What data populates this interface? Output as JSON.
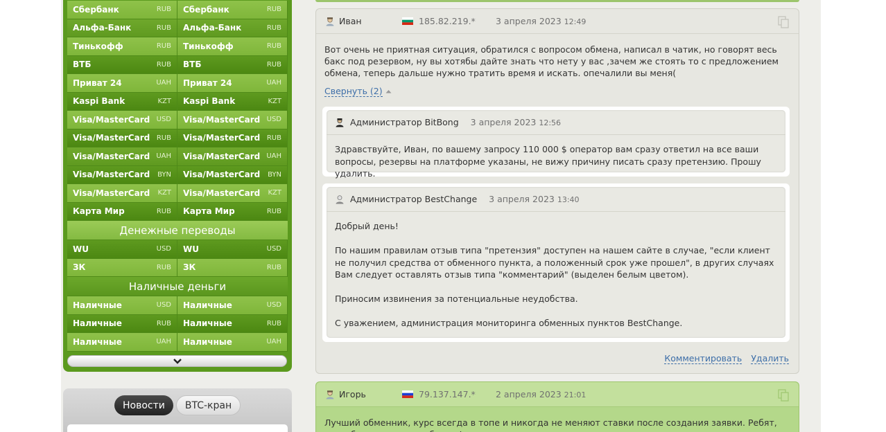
{
  "currency_rows": [
    {
      "left": {
        "name": "Сбербанк",
        "code": "RUB"
      },
      "right": {
        "name": "Сбербанк",
        "code": "RUB"
      }
    },
    {
      "left": {
        "name": "Альфа-Банк",
        "code": "RUB"
      },
      "right": {
        "name": "Альфа-Банк",
        "code": "RUB"
      }
    },
    {
      "left": {
        "name": "Тинькофф",
        "code": "RUB"
      },
      "right": {
        "name": "Тинькофф",
        "code": "RUB"
      }
    },
    {
      "left": {
        "name": "ВТБ",
        "code": "RUB"
      },
      "right": {
        "name": "ВТБ",
        "code": "RUB"
      }
    },
    {
      "left": {
        "name": "Приват 24",
        "code": "UAH"
      },
      "right": {
        "name": "Приват 24",
        "code": "UAH"
      }
    },
    {
      "left": {
        "name": "Kaspi Bank",
        "code": "KZT"
      },
      "right": {
        "name": "Kaspi Bank",
        "code": "KZT"
      }
    },
    {
      "left": {
        "name": "Visa/MasterCard",
        "code": "USD"
      },
      "right": {
        "name": "Visa/MasterCard",
        "code": "USD"
      }
    },
    {
      "left": {
        "name": "Visa/MasterCard",
        "code": "RUB"
      },
      "right": {
        "name": "Visa/MasterCard",
        "code": "RUB"
      }
    },
    {
      "left": {
        "name": "Visa/MasterCard",
        "code": "UAH"
      },
      "right": {
        "name": "Visa/MasterCard",
        "code": "UAH"
      }
    },
    {
      "left": {
        "name": "Visa/MasterCard",
        "code": "BYN"
      },
      "right": {
        "name": "Visa/MasterCard",
        "code": "BYN"
      }
    },
    {
      "left": {
        "name": "Visa/MasterCard",
        "code": "KZT"
      },
      "right": {
        "name": "Visa/MasterCard",
        "code": "KZT"
      }
    },
    {
      "left": {
        "name": "Карта Мир",
        "code": "RUB"
      },
      "right": {
        "name": "Карта Мир",
        "code": "RUB"
      }
    }
  ],
  "section_money_transfers": "Денежные переводы",
  "transfer_rows": [
    {
      "left": {
        "name": "WU",
        "code": "USD"
      },
      "right": {
        "name": "WU",
        "code": "USD"
      }
    },
    {
      "left": {
        "name": "ЗК",
        "code": "RUB"
      },
      "right": {
        "name": "ЗК",
        "code": "RUB"
      }
    }
  ],
  "section_cash": "Наличные деньги",
  "cash_rows": [
    {
      "left": {
        "name": "Наличные",
        "code": "USD"
      },
      "right": {
        "name": "Наличные",
        "code": "USD"
      }
    },
    {
      "left": {
        "name": "Наличные",
        "code": "RUB"
      },
      "right": {
        "name": "Наличные",
        "code": "RUB"
      }
    },
    {
      "left": {
        "name": "Наличные",
        "code": "UAH"
      },
      "right": {
        "name": "Наличные",
        "code": "UAH"
      }
    }
  ],
  "news": {
    "tab_news": "Новости",
    "tab_btc": "BTC-кран"
  },
  "review1": {
    "author": "Иван",
    "ip": "185.82.219.*",
    "date": "3 апреля 2023",
    "time": "12:49",
    "text": "Вот очень не приятная ситуация, обратился с вопросом обмена, написал в чатик, но говорят весь бакс под резервом, ну вы хотябы дайте знать что нету у вас ,зачем же стоять то с предложением обмена, теперь дальше нужно тратить время и искать. опечалили вы меня(",
    "toggle": "Свернуть (2)",
    "comment_link": "Комментировать",
    "delete_link": "Удалить"
  },
  "reply1": {
    "author": "Администратор BitBong",
    "date": "3 апреля 2023",
    "time": "12:56",
    "text": "Здравствуйте, Иван, по вашему запросу 110 000 $ оператор вам сразу ответил на все ваши вопросы, резервы на платформе указаны, не вижу причину писать сразу претензию. Прошу удалить."
  },
  "reply2": {
    "author": "Администратор BestChange",
    "date": "3 апреля 2023",
    "time": "13:40",
    "p1": "Добрый день!",
    "p2": "По нашим правилам отзыв типа \"претензия\" доступен на нашем сайте в случае, \"если клиент не получил средства от обменного пункта, а положенный срок уже прошел\", в других случаях Вам следует оставлять отзыв типа \"комментарий\" (выделен белым цветом).",
    "p3": "Приносим извинения за потенциальные неудобства.",
    "p4": "С уважением, администрация мониторинга обменных пунктов BestChange."
  },
  "review2": {
    "author": "Игорь",
    "ip": "79.137.147.*",
    "date": "2 апреля 2023",
    "time": "21:01",
    "text": "Лучший обменник, курс всегда в топе и никогда не меняют ставки после создания заявки. Ребят, спасибо за отличные обмены!"
  }
}
